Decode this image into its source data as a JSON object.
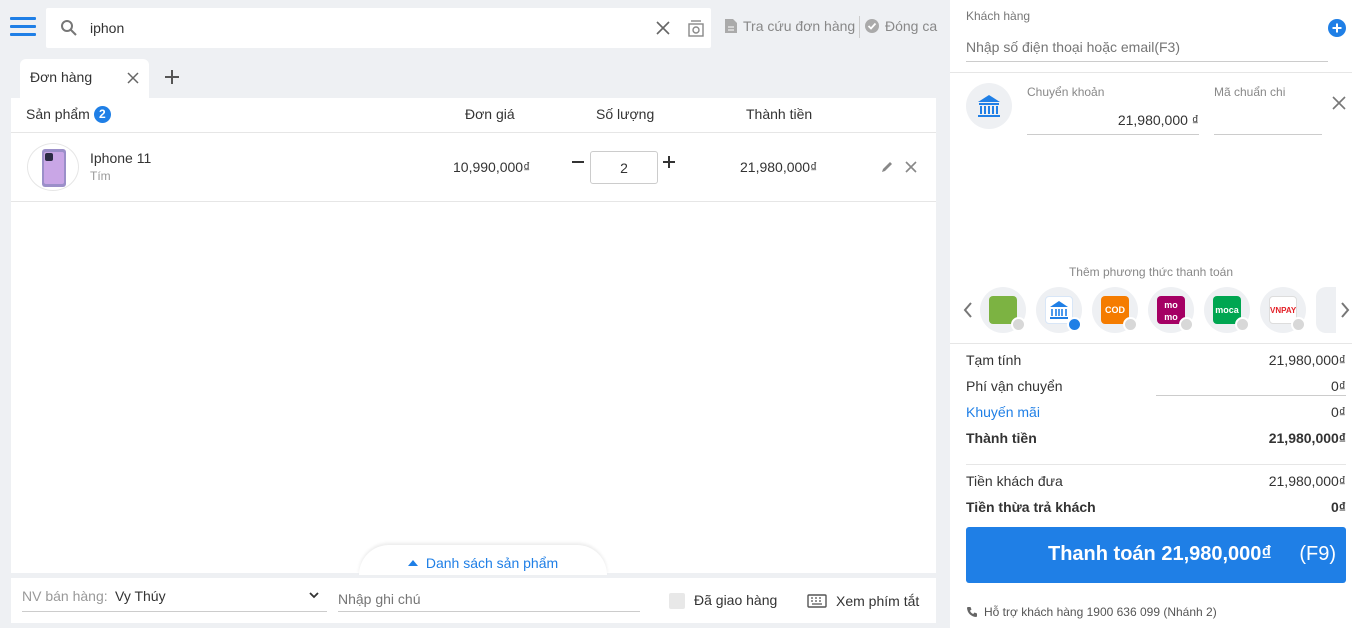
{
  "search": {
    "value": "iphon"
  },
  "toplinks": {
    "lookup": "Tra cứu đơn hàng",
    "close_shift": "Đóng ca"
  },
  "tabs": [
    {
      "label": "Đơn hàng"
    }
  ],
  "table": {
    "headers": {
      "product": "Sản phẩm",
      "count": "2",
      "unit_price": "Đơn giá",
      "quantity": "Số lượng",
      "total": "Thành tiền"
    },
    "rows": [
      {
        "name": "Iphone 11",
        "variant": "Tím",
        "price": "10,990,000₫",
        "qty": "2",
        "total": "21,980,000₫"
      }
    ]
  },
  "product_list_toggle": "Danh sách sản phẩm",
  "bottom": {
    "staff_label": "NV bán hàng:",
    "staff_value": "Vy Thúy",
    "note_placeholder": "Nhập ghi chú",
    "delivered_label": "Đã giao hàng",
    "shortcuts_label": "Xem phím tắt"
  },
  "customer": {
    "label": "Khách hàng",
    "placeholder": "Nhập số điện thoại hoặc email(F3)"
  },
  "payment_line": {
    "method_label": "Chuyển khoản",
    "amount": "21,980,000 ₫",
    "auth_label": "Mã chuẩn chi"
  },
  "add_method_label": "Thêm phương thức thanh toán",
  "methods": [
    {
      "name": "cash",
      "text": "",
      "color": "#7cb342"
    },
    {
      "name": "bank-transfer",
      "text": "",
      "color": "#1f7fe6",
      "selected": true
    },
    {
      "name": "cod",
      "text": "COD",
      "color": "#f57c00"
    },
    {
      "name": "momo",
      "text": "mo mo",
      "color": "#a50064"
    },
    {
      "name": "moca",
      "text": "moca",
      "color": "#00a651"
    },
    {
      "name": "vnpay",
      "text": "VNPAY",
      "color": "#e31e25"
    }
  ],
  "summary": {
    "subtotal_label": "Tạm tính",
    "subtotal": "21,980,000₫",
    "shipping_label": "Phí vận chuyển",
    "shipping": "0₫",
    "promo_label": "Khuyến mãi",
    "promo": "0₫",
    "total_label": "Thành tiền",
    "total": "21,980,000₫",
    "paid_label": "Tiền khách đưa",
    "paid": "21,980,000₫",
    "change_label": "Tiền thừa trả khách",
    "change": "0₫"
  },
  "pay_button": {
    "label": "Thanh toán 21,980,000₫",
    "key": "(F9)"
  },
  "support": "Hỗ trợ khách hàng 1900 636 099 (Nhánh 2)",
  "colors": {
    "accent": "#1f7fe6"
  }
}
